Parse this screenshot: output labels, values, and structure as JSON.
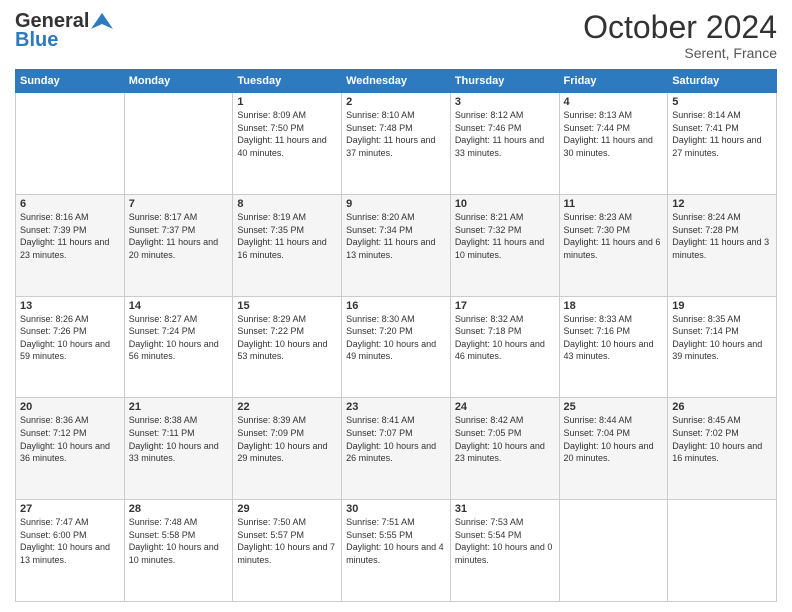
{
  "header": {
    "logo_general": "General",
    "logo_blue": "Blue",
    "month_year": "October 2024",
    "location": "Serent, France"
  },
  "days_of_week": [
    "Sunday",
    "Monday",
    "Tuesday",
    "Wednesday",
    "Thursday",
    "Friday",
    "Saturday"
  ],
  "weeks": [
    [
      {
        "day": "",
        "sunrise": "",
        "sunset": "",
        "daylight": ""
      },
      {
        "day": "",
        "sunrise": "",
        "sunset": "",
        "daylight": ""
      },
      {
        "day": "1",
        "sunrise": "Sunrise: 8:09 AM",
        "sunset": "Sunset: 7:50 PM",
        "daylight": "Daylight: 11 hours and 40 minutes."
      },
      {
        "day": "2",
        "sunrise": "Sunrise: 8:10 AM",
        "sunset": "Sunset: 7:48 PM",
        "daylight": "Daylight: 11 hours and 37 minutes."
      },
      {
        "day": "3",
        "sunrise": "Sunrise: 8:12 AM",
        "sunset": "Sunset: 7:46 PM",
        "daylight": "Daylight: 11 hours and 33 minutes."
      },
      {
        "day": "4",
        "sunrise": "Sunrise: 8:13 AM",
        "sunset": "Sunset: 7:44 PM",
        "daylight": "Daylight: 11 hours and 30 minutes."
      },
      {
        "day": "5",
        "sunrise": "Sunrise: 8:14 AM",
        "sunset": "Sunset: 7:41 PM",
        "daylight": "Daylight: 11 hours and 27 minutes."
      }
    ],
    [
      {
        "day": "6",
        "sunrise": "Sunrise: 8:16 AM",
        "sunset": "Sunset: 7:39 PM",
        "daylight": "Daylight: 11 hours and 23 minutes."
      },
      {
        "day": "7",
        "sunrise": "Sunrise: 8:17 AM",
        "sunset": "Sunset: 7:37 PM",
        "daylight": "Daylight: 11 hours and 20 minutes."
      },
      {
        "day": "8",
        "sunrise": "Sunrise: 8:19 AM",
        "sunset": "Sunset: 7:35 PM",
        "daylight": "Daylight: 11 hours and 16 minutes."
      },
      {
        "day": "9",
        "sunrise": "Sunrise: 8:20 AM",
        "sunset": "Sunset: 7:34 PM",
        "daylight": "Daylight: 11 hours and 13 minutes."
      },
      {
        "day": "10",
        "sunrise": "Sunrise: 8:21 AM",
        "sunset": "Sunset: 7:32 PM",
        "daylight": "Daylight: 11 hours and 10 minutes."
      },
      {
        "day": "11",
        "sunrise": "Sunrise: 8:23 AM",
        "sunset": "Sunset: 7:30 PM",
        "daylight": "Daylight: 11 hours and 6 minutes."
      },
      {
        "day": "12",
        "sunrise": "Sunrise: 8:24 AM",
        "sunset": "Sunset: 7:28 PM",
        "daylight": "Daylight: 11 hours and 3 minutes."
      }
    ],
    [
      {
        "day": "13",
        "sunrise": "Sunrise: 8:26 AM",
        "sunset": "Sunset: 7:26 PM",
        "daylight": "Daylight: 10 hours and 59 minutes."
      },
      {
        "day": "14",
        "sunrise": "Sunrise: 8:27 AM",
        "sunset": "Sunset: 7:24 PM",
        "daylight": "Daylight: 10 hours and 56 minutes."
      },
      {
        "day": "15",
        "sunrise": "Sunrise: 8:29 AM",
        "sunset": "Sunset: 7:22 PM",
        "daylight": "Daylight: 10 hours and 53 minutes."
      },
      {
        "day": "16",
        "sunrise": "Sunrise: 8:30 AM",
        "sunset": "Sunset: 7:20 PM",
        "daylight": "Daylight: 10 hours and 49 minutes."
      },
      {
        "day": "17",
        "sunrise": "Sunrise: 8:32 AM",
        "sunset": "Sunset: 7:18 PM",
        "daylight": "Daylight: 10 hours and 46 minutes."
      },
      {
        "day": "18",
        "sunrise": "Sunrise: 8:33 AM",
        "sunset": "Sunset: 7:16 PM",
        "daylight": "Daylight: 10 hours and 43 minutes."
      },
      {
        "day": "19",
        "sunrise": "Sunrise: 8:35 AM",
        "sunset": "Sunset: 7:14 PM",
        "daylight": "Daylight: 10 hours and 39 minutes."
      }
    ],
    [
      {
        "day": "20",
        "sunrise": "Sunrise: 8:36 AM",
        "sunset": "Sunset: 7:12 PM",
        "daylight": "Daylight: 10 hours and 36 minutes."
      },
      {
        "day": "21",
        "sunrise": "Sunrise: 8:38 AM",
        "sunset": "Sunset: 7:11 PM",
        "daylight": "Daylight: 10 hours and 33 minutes."
      },
      {
        "day": "22",
        "sunrise": "Sunrise: 8:39 AM",
        "sunset": "Sunset: 7:09 PM",
        "daylight": "Daylight: 10 hours and 29 minutes."
      },
      {
        "day": "23",
        "sunrise": "Sunrise: 8:41 AM",
        "sunset": "Sunset: 7:07 PM",
        "daylight": "Daylight: 10 hours and 26 minutes."
      },
      {
        "day": "24",
        "sunrise": "Sunrise: 8:42 AM",
        "sunset": "Sunset: 7:05 PM",
        "daylight": "Daylight: 10 hours and 23 minutes."
      },
      {
        "day": "25",
        "sunrise": "Sunrise: 8:44 AM",
        "sunset": "Sunset: 7:04 PM",
        "daylight": "Daylight: 10 hours and 20 minutes."
      },
      {
        "day": "26",
        "sunrise": "Sunrise: 8:45 AM",
        "sunset": "Sunset: 7:02 PM",
        "daylight": "Daylight: 10 hours and 16 minutes."
      }
    ],
    [
      {
        "day": "27",
        "sunrise": "Sunrise: 7:47 AM",
        "sunset": "Sunset: 6:00 PM",
        "daylight": "Daylight: 10 hours and 13 minutes."
      },
      {
        "day": "28",
        "sunrise": "Sunrise: 7:48 AM",
        "sunset": "Sunset: 5:58 PM",
        "daylight": "Daylight: 10 hours and 10 minutes."
      },
      {
        "day": "29",
        "sunrise": "Sunrise: 7:50 AM",
        "sunset": "Sunset: 5:57 PM",
        "daylight": "Daylight: 10 hours and 7 minutes."
      },
      {
        "day": "30",
        "sunrise": "Sunrise: 7:51 AM",
        "sunset": "Sunset: 5:55 PM",
        "daylight": "Daylight: 10 hours and 4 minutes."
      },
      {
        "day": "31",
        "sunrise": "Sunrise: 7:53 AM",
        "sunset": "Sunset: 5:54 PM",
        "daylight": "Daylight: 10 hours and 0 minutes."
      },
      {
        "day": "",
        "sunrise": "",
        "sunset": "",
        "daylight": ""
      },
      {
        "day": "",
        "sunrise": "",
        "sunset": "",
        "daylight": ""
      }
    ]
  ]
}
